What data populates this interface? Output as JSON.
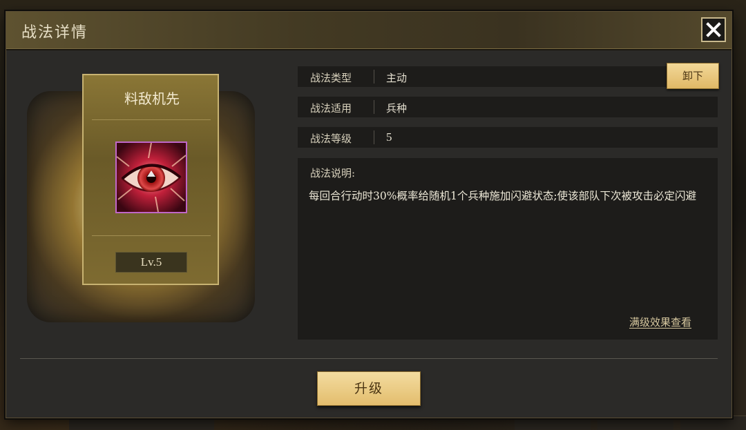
{
  "dialog": {
    "title": "战法详情",
    "close_icon": "close-icon"
  },
  "skill_card": {
    "name": "料敌机先",
    "icon": "eye-icon",
    "level_label": "Lv.5"
  },
  "info": {
    "type_label": "战法类型",
    "type_value": "主动",
    "apply_label": "战法适用",
    "apply_value": "兵种",
    "level_label": "战法等级",
    "level_value": "5",
    "unequip_label": "卸下"
  },
  "description": {
    "title": "战法说明:",
    "text": "每回合行动时30%概率给随机1个兵种施加闪避状态;使该部队下次被攻击必定闪避",
    "max_level_link": "满级效果查看"
  },
  "actions": {
    "upgrade_label": "升级"
  },
  "colors": {
    "gold_button": "#e3bd6d",
    "title_bar": "#433a23",
    "panel_bg": "#2b2a28",
    "row_bg": "#1d1c1a",
    "icon_border": "#c067c9"
  }
}
